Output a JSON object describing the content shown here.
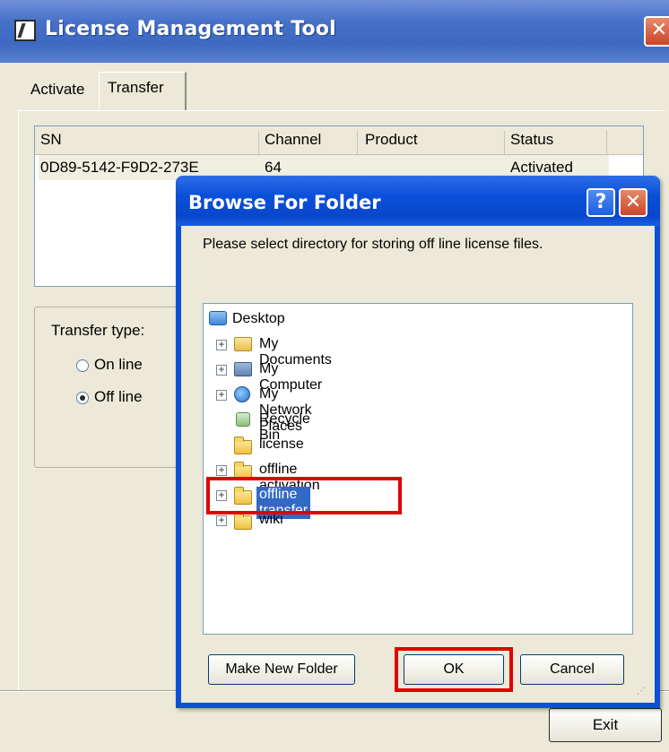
{
  "main_window": {
    "title": "License Management Tool",
    "close_glyph": "✕",
    "tabs": [
      {
        "label": "Activate"
      },
      {
        "label": "Transfer"
      }
    ],
    "table": {
      "headers": [
        "SN",
        "Channel",
        "Product",
        "Status"
      ],
      "rows": [
        {
          "sn": "0D89-5142-F9D2-273E",
          "channel": "64",
          "product": "",
          "status": "Activated"
        }
      ]
    },
    "transfer_group": {
      "label": "Transfer type:",
      "options": [
        {
          "label": "On line",
          "checked": false
        },
        {
          "label": "Off line",
          "checked": true
        }
      ]
    },
    "exit_label": "Exit"
  },
  "dialog": {
    "title": "Browse For Folder",
    "help_glyph": "?",
    "close_glyph": "✕",
    "instruction": "Please select directory for storing off line license files.",
    "tree": [
      {
        "label": "Desktop",
        "icon": "desktop-icon",
        "expander": false
      },
      {
        "label": "My Documents",
        "icon": "my-documents-icon",
        "expander": true
      },
      {
        "label": "My Computer",
        "icon": "my-computer-icon",
        "expander": true
      },
      {
        "label": "My Network Places",
        "icon": "network-places-icon",
        "expander": true
      },
      {
        "label": "Recycle Bin",
        "icon": "recycle-bin-icon",
        "expander": false
      },
      {
        "label": "license",
        "icon": "folder-icon",
        "expander": false
      },
      {
        "label": "offline activation",
        "icon": "folder-icon",
        "expander": true
      },
      {
        "label": "offline transfer",
        "icon": "folder-icon",
        "expander": true,
        "selected": true
      },
      {
        "label": "wiki",
        "icon": "folder-icon",
        "expander": true
      }
    ],
    "buttons": {
      "make_new_folder": "Make New Folder",
      "ok": "OK",
      "cancel": "Cancel"
    },
    "expander_glyph": "+"
  },
  "colors": {
    "xp_blue": "#0b51d8",
    "selection": "#316ac5",
    "highlight_red": "#e00000",
    "window_face": "#ece9d8"
  }
}
